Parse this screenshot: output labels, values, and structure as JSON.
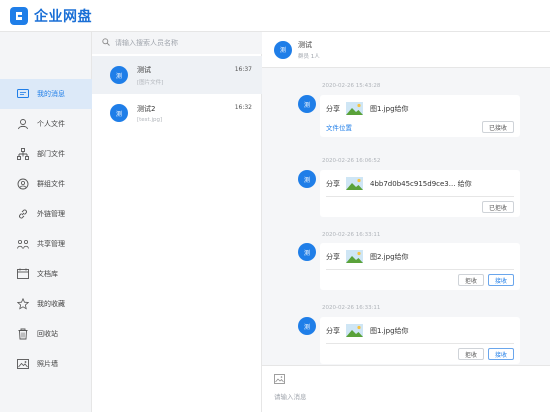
{
  "app": {
    "title": "企业网盘"
  },
  "sidebar": {
    "items": [
      {
        "label": "我的消息",
        "icon": "message-icon"
      },
      {
        "label": "个人文件",
        "icon": "user-icon"
      },
      {
        "label": "部门文件",
        "icon": "org-chart-icon"
      },
      {
        "label": "群组文件",
        "icon": "group-icon"
      },
      {
        "label": "外链管理",
        "icon": "link-icon"
      },
      {
        "label": "共享管理",
        "icon": "share-icon"
      },
      {
        "label": "文档库",
        "icon": "document-library-icon"
      },
      {
        "label": "我的收藏",
        "icon": "star-icon"
      },
      {
        "label": "回收站",
        "icon": "trash-icon"
      },
      {
        "label": "照片墙",
        "icon": "photo-icon"
      }
    ]
  },
  "search": {
    "placeholder": "请输入搜索人员名称"
  },
  "conversations": [
    {
      "avatar": "测",
      "name": "测试",
      "preview": "[图片文件]",
      "time": "16:37"
    },
    {
      "avatar": "测",
      "name": "测试2",
      "preview": "[test.jpg]",
      "time": "16:32"
    }
  ],
  "chat": {
    "header": {
      "avatar": "测",
      "name": "测试",
      "subtitle": "群员 1人"
    },
    "messages": [
      {
        "timestamp": "2020-02-26 15:43:28",
        "avatar": "测",
        "share_label": "分享",
        "file_name": "图1.jpg给你",
        "link": "文件位置",
        "buttons": [
          "已接收"
        ]
      },
      {
        "timestamp": "2020-02-26 16:06:52",
        "avatar": "测",
        "share_label": "分享",
        "file_name": "4bb7d0b45c915d9ce3... 给你",
        "link": "",
        "buttons": [
          "已拒收"
        ]
      },
      {
        "timestamp": "2020-02-26 16:33:11",
        "avatar": "测",
        "share_label": "分享",
        "file_name": "图2.jpg给你",
        "link": "",
        "buttons": [
          "拒收",
          "接收"
        ]
      },
      {
        "timestamp": "2020-02-26 16:33:11",
        "avatar": "测",
        "share_label": "分享",
        "file_name": "图1.jpg给你",
        "link": "",
        "buttons": [
          "拒收",
          "接收"
        ]
      }
    ],
    "composer": {
      "placeholder": "请输入消息",
      "tool_icon": "image-upload-icon"
    }
  },
  "colors": {
    "accent": "#1f7ee8",
    "sidebar_bg": "#f4f5f7",
    "active_bg": "#dce9f8"
  }
}
